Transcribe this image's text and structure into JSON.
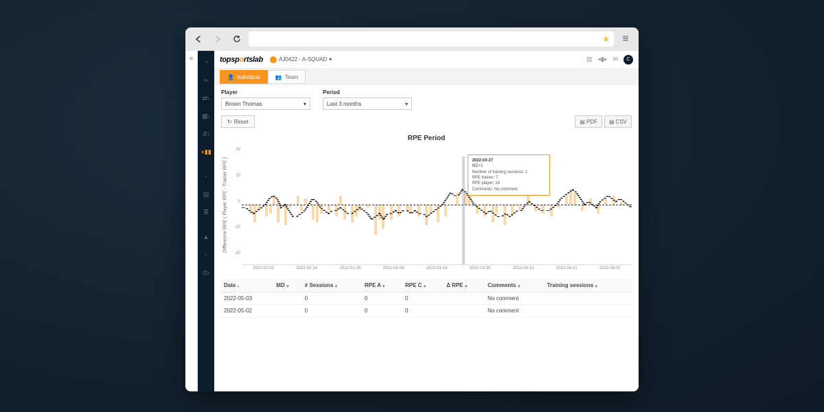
{
  "header": {
    "logo_left": "topsp",
    "logo_o": "o",
    "logo_right": "rtslab",
    "squad": "AJ0422 - A-SQUAD",
    "squad_caret": "▾"
  },
  "tabs": {
    "individual": "Individual",
    "team": "Team"
  },
  "filters": {
    "player_label": "Player",
    "player_value": "Brown Thomas",
    "period_label": "Period",
    "period_value": "Last 3 months",
    "reset": "Reset"
  },
  "exports": {
    "pdf": "PDF",
    "csv": "CSV"
  },
  "chart_data": {
    "type": "bar+line",
    "title": "RPE Period",
    "ylabel": "Difference RPE ( Player RPE - Trainer RPE )",
    "ylim": [
      -20,
      20
    ],
    "yticks": [
      20,
      10,
      0,
      -10,
      -20
    ],
    "x_ticks": [
      "2022-02-03",
      "2022-02-14",
      "2022-02-25",
      "2022-03-08",
      "2022-03-19",
      "2022-03-30",
      "2022-04-10",
      "2022-04-21",
      "2022-05-02"
    ],
    "bars": [
      {
        "pos": 2,
        "v": -3
      },
      {
        "pos": 3,
        "v": -6
      },
      {
        "pos": 4,
        "v": -2
      },
      {
        "pos": 6,
        "v": -4
      },
      {
        "pos": 7,
        "v": -3
      },
      {
        "pos": 8,
        "v": 3
      },
      {
        "pos": 9,
        "v": -6
      },
      {
        "pos": 11,
        "v": -7
      },
      {
        "pos": 12,
        "v": -1
      },
      {
        "pos": 14,
        "v": 3
      },
      {
        "pos": 15,
        "v": -2
      },
      {
        "pos": 16,
        "v": 2
      },
      {
        "pos": 18,
        "v": -5
      },
      {
        "pos": 19,
        "v": -6
      },
      {
        "pos": 20,
        "v": -3
      },
      {
        "pos": 22,
        "v": -2
      },
      {
        "pos": 24,
        "v": -4
      },
      {
        "pos": 25,
        "v": 3
      },
      {
        "pos": 26,
        "v": -5
      },
      {
        "pos": 28,
        "v": -6
      },
      {
        "pos": 29,
        "v": -4
      },
      {
        "pos": 30,
        "v": -2
      },
      {
        "pos": 32,
        "v": -1
      },
      {
        "pos": 34,
        "v": -10
      },
      {
        "pos": 35,
        "v": -5
      },
      {
        "pos": 36,
        "v": -8
      },
      {
        "pos": 38,
        "v": -5
      },
      {
        "pos": 40,
        "v": -4
      },
      {
        "pos": 42,
        "v": -2
      },
      {
        "pos": 43,
        "v": -3
      },
      {
        "pos": 45,
        "v": -4
      },
      {
        "pos": 47,
        "v": -7
      },
      {
        "pos": 48,
        "v": -3
      },
      {
        "pos": 50,
        "v": -6
      },
      {
        "pos": 52,
        "v": -4
      },
      {
        "pos": 55,
        "v": 4
      },
      {
        "pos": 57,
        "v": 4
      },
      {
        "pos": 58,
        "v": 3
      },
      {
        "pos": 60,
        "v": -3
      },
      {
        "pos": 62,
        "v": -4
      },
      {
        "pos": 64,
        "v": -6
      },
      {
        "pos": 65,
        "v": -3
      },
      {
        "pos": 67,
        "v": -7
      },
      {
        "pos": 69,
        "v": -4
      },
      {
        "pos": 71,
        "v": -2
      },
      {
        "pos": 73,
        "v": 3
      },
      {
        "pos": 75,
        "v": -2
      },
      {
        "pos": 77,
        "v": -3
      },
      {
        "pos": 79,
        "v": -4
      },
      {
        "pos": 81,
        "v": -1
      },
      {
        "pos": 83,
        "v": 3
      },
      {
        "pos": 84,
        "v": 5
      },
      {
        "pos": 85,
        "v": 4
      },
      {
        "pos": 87,
        "v": -2
      },
      {
        "pos": 89,
        "v": 2
      },
      {
        "pos": 91,
        "v": -3
      },
      {
        "pos": 93,
        "v": 2
      },
      {
        "pos": 95,
        "v": 3
      },
      {
        "pos": 97,
        "v": 1
      },
      {
        "pos": 99,
        "v": -1
      }
    ],
    "line": [
      -1,
      -1,
      -2,
      -3,
      -2,
      -1,
      0,
      2,
      3,
      2,
      -1,
      0,
      -2,
      -4,
      -4,
      -3,
      -2,
      0,
      2,
      1,
      -1,
      -2,
      -3,
      -2,
      -2,
      -1,
      -2,
      -3,
      -3,
      -2,
      -1,
      -2,
      -3,
      -5,
      -4,
      -3,
      -5,
      -3,
      -3,
      -2,
      -3,
      -2,
      -2,
      -3,
      -2,
      -3,
      -3,
      -4,
      -3,
      -2,
      -1,
      0,
      2,
      4,
      3,
      3,
      5,
      4,
      2,
      0,
      -1,
      -2,
      -3,
      -2,
      -3,
      -4,
      -4,
      -3,
      -4,
      -3,
      -2,
      -2,
      0,
      1,
      0,
      -1,
      -2,
      -2,
      -2,
      -1,
      0,
      2,
      3,
      4,
      5,
      4,
      2,
      0,
      1,
      0,
      -1,
      1,
      2,
      3,
      2,
      1,
      2,
      1,
      0,
      -1
    ],
    "tooltip": {
      "date": "2022-03-27",
      "md": "MD+1",
      "sessions": "Number of training sessions: 1",
      "rpe_trainer": "RPE trainer: 7",
      "rpe_player": "RPE player: 18",
      "comments": "Comments: No comment"
    }
  },
  "table": {
    "cols": [
      "Date",
      "MD",
      "# Sessions",
      "RPE A",
      "RPE C",
      "Δ RPE",
      "Comments",
      "Training sessions"
    ],
    "rows": [
      {
        "date": "2022-05-03",
        "md": "",
        "sessions": "0",
        "rpeA": "0",
        "rpeC": "0",
        "delta": "",
        "comments": "No comment",
        "training": ""
      },
      {
        "date": "2022-05-02",
        "md": "",
        "sessions": "0",
        "rpeA": "0",
        "rpeC": "0",
        "delta": "",
        "comments": "No comment",
        "training": ""
      }
    ]
  }
}
